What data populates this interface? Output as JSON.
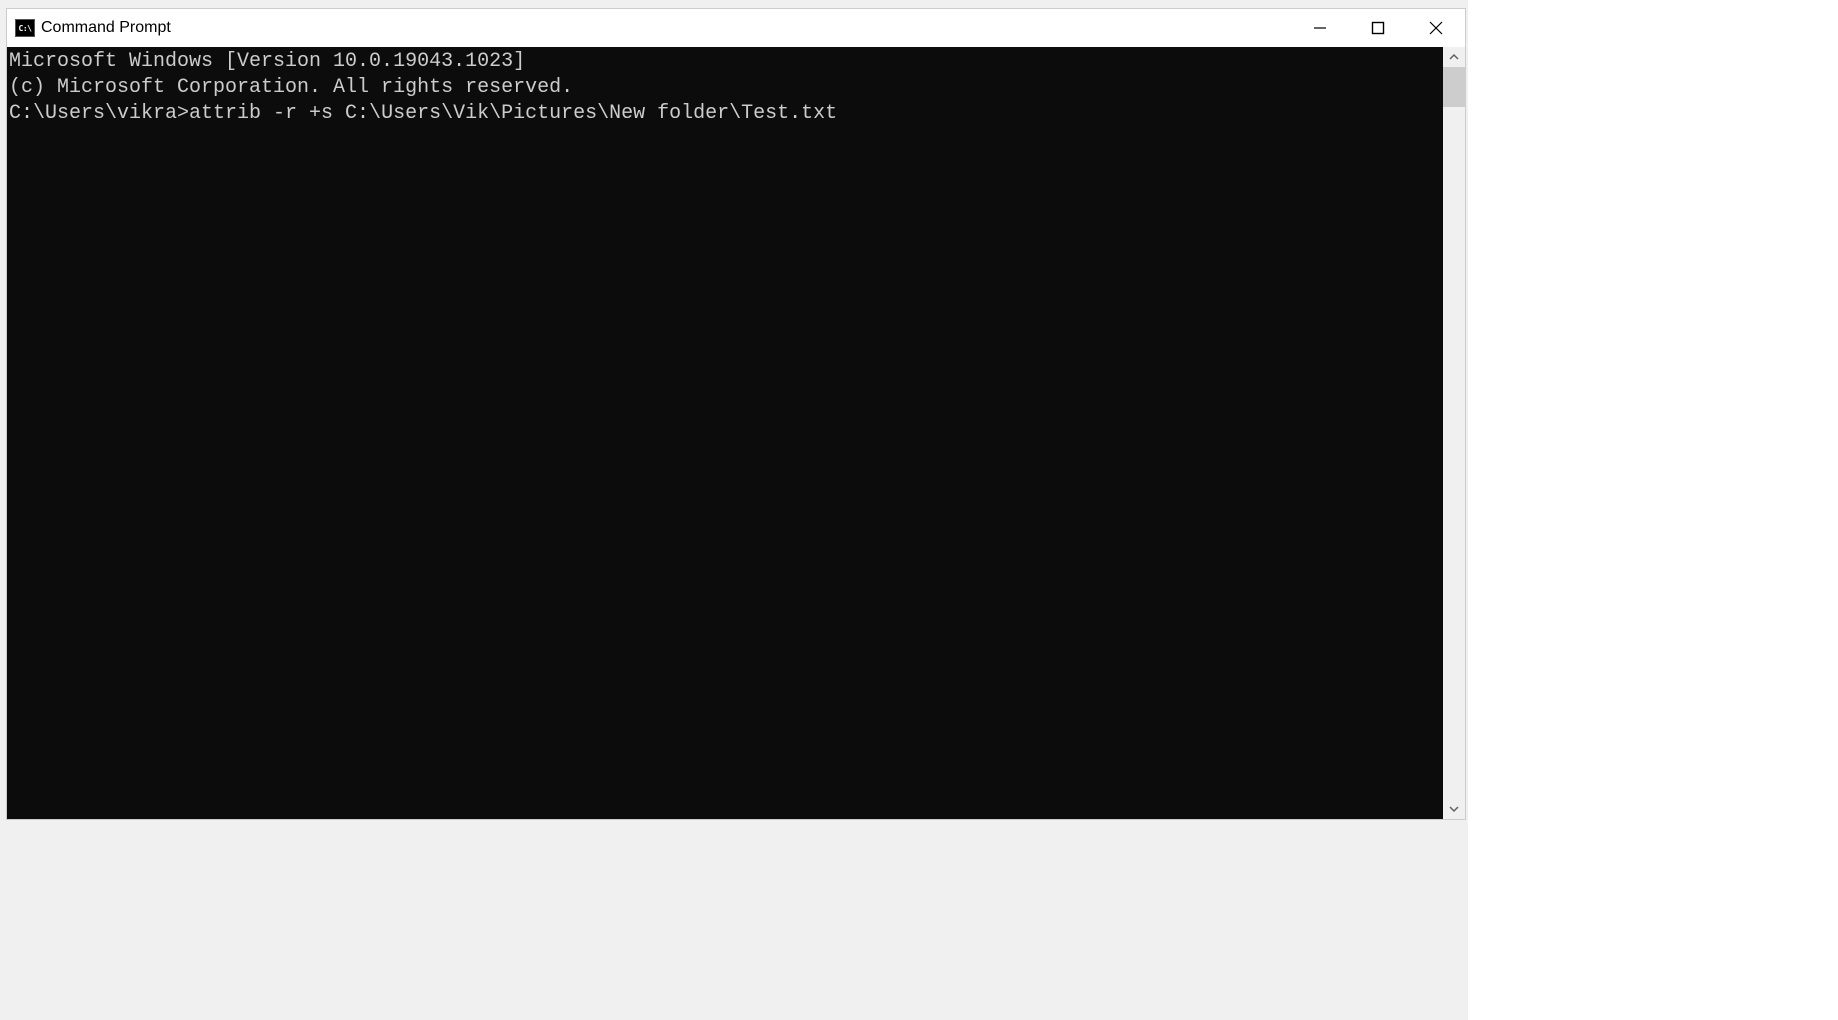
{
  "window": {
    "title": "Command Prompt",
    "icon_label": "C:\\"
  },
  "terminal": {
    "line1": "Microsoft Windows [Version 10.0.19043.1023]",
    "line2": "(c) Microsoft Corporation. All rights reserved.",
    "blank": "",
    "prompt": "C:\\Users\\vikra>",
    "command": "attrib -r +s C:\\Users\\Vik\\Pictures\\New folder\\Test.txt"
  },
  "controls": {
    "minimize": "Minimize",
    "maximize": "Maximize",
    "close": "Close"
  }
}
